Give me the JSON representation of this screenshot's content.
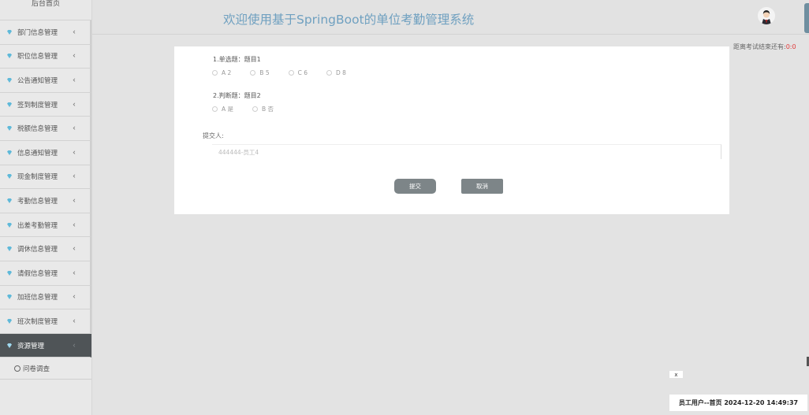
{
  "sidebar": {
    "home": "后台首页",
    "items": [
      {
        "label": "部门信息管理"
      },
      {
        "label": "职位信息管理"
      },
      {
        "label": "公告通知管理"
      },
      {
        "label": "签到制度管理"
      },
      {
        "label": "税额信息管理"
      },
      {
        "label": "信息通知管理"
      },
      {
        "label": "现金制度管理"
      },
      {
        "label": "考勤信息管理"
      },
      {
        "label": "出差考勤管理"
      },
      {
        "label": "调休信息管理"
      },
      {
        "label": "请假信息管理"
      },
      {
        "label": "加班信息管理"
      },
      {
        "label": "班次制度管理"
      },
      {
        "label": "资源管理"
      }
    ],
    "sub_item": "问卷调查",
    "chevron": "‹",
    "active_index": 13,
    "icon_color": "#5fb9d9"
  },
  "header": {
    "title": "欢迎使用基于SpringBoot的单位考勤管理系统"
  },
  "countdown": {
    "label": "距离考试结束还有:",
    "value": "0:0"
  },
  "form": {
    "q1": {
      "title": "1.单选题：题目1",
      "options": [
        "A 2",
        "B 5",
        "C 6",
        "D 8"
      ]
    },
    "q2": {
      "title": "2.判断题：题目2",
      "options": [
        "A 是",
        "B 否"
      ]
    },
    "submitter_label": "提交人:",
    "submitter_value": "444444-员工4",
    "submit_label": "提交",
    "cancel_label": "取消"
  },
  "close_label": "x",
  "status": "员工用户--首页 2024-12-20 14:49:37"
}
